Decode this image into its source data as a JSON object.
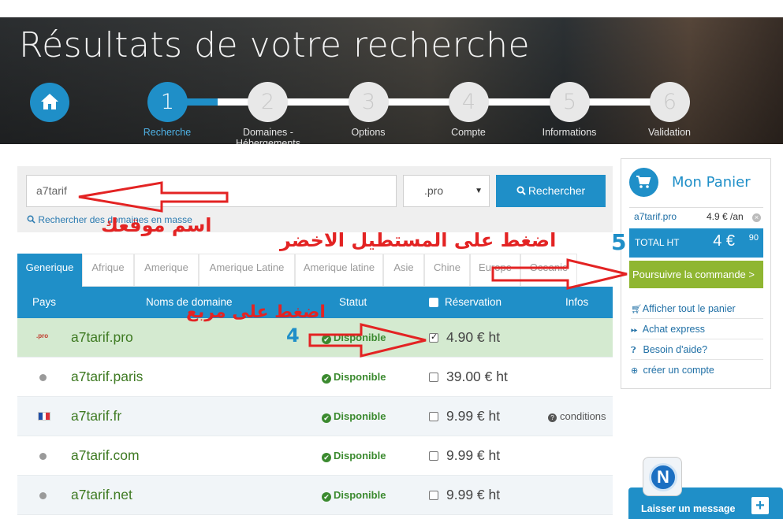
{
  "hero": {
    "title": "Résultats de votre recherche",
    "home_icon": "home-icon",
    "steps": [
      {
        "num": "1",
        "label": "Recherche"
      },
      {
        "num": "2",
        "label": "Domaines - Hébergements"
      },
      {
        "num": "3",
        "label": "Options"
      },
      {
        "num": "4",
        "label": "Compte"
      },
      {
        "num": "5",
        "label": "Informations"
      },
      {
        "num": "6",
        "label": "Validation"
      }
    ]
  },
  "search": {
    "domain_value": "a7tarif",
    "tld_value": ".pro",
    "button_label": "Rechercher",
    "bulk_link": "Rechercher des domaines en masse"
  },
  "tabs": [
    "Generique",
    "Afrique",
    "Amerique",
    "Amerique Latine",
    "Amerique latine",
    "Asie",
    "Chine",
    "Europe",
    "Oceanie"
  ],
  "table": {
    "headers": {
      "country": "Pays",
      "domains": "Noms de domaine",
      "status": "Statut",
      "reservation": "Réservation",
      "info": "Infos"
    },
    "rows": [
      {
        "flag": ".pro",
        "domain": "a7tarif.pro",
        "status": "Disponible",
        "checked": true,
        "price": "4.90 € ht",
        "info": ""
      },
      {
        "flag": "",
        "domain": "a7tarif.paris",
        "status": "Disponible",
        "checked": false,
        "price": "39.00 € ht",
        "info": ""
      },
      {
        "flag": "fr",
        "domain": "a7tarif.fr",
        "status": "Disponible",
        "checked": false,
        "price": "9.99 € ht",
        "info": "conditions"
      },
      {
        "flag": "",
        "domain": "a7tarif.com",
        "status": "Disponible",
        "checked": false,
        "price": "9.99 € ht",
        "info": ""
      },
      {
        "flag": "",
        "domain": "a7tarif.net",
        "status": "Disponible",
        "checked": false,
        "price": "9.99 € ht",
        "info": ""
      }
    ]
  },
  "cart": {
    "title": "Mon Panier",
    "item_name": "a7tarif.pro",
    "item_price": "4.9 € /an",
    "total_label": "TOTAL HT",
    "total_amount": "4 €",
    "total_cents": "90",
    "proceed_label": "Poursuivre la commande >",
    "links": [
      {
        "icon": "cart-icon",
        "label": "Afficher tout le panier"
      },
      {
        "icon": "fast-forward-icon",
        "label": "Achat express"
      },
      {
        "icon": "question-icon",
        "label": "Besoin d'aide?"
      },
      {
        "icon": "plus-circle-icon",
        "label": "créer un compte"
      }
    ]
  },
  "chat": {
    "label": "Laisser un message",
    "logo_letter": "N"
  },
  "annotations": {
    "site_name": "اسم موقعك",
    "click_box": "اضغط على مربع",
    "click_green": "اضغط على  المستطيل الاخضر",
    "num4": "4",
    "num5": "5"
  },
  "colors": {
    "primary": "#1f8fc8",
    "green_button": "#8fb631",
    "available": "#3b8a2f",
    "annotation": "#e32323"
  }
}
